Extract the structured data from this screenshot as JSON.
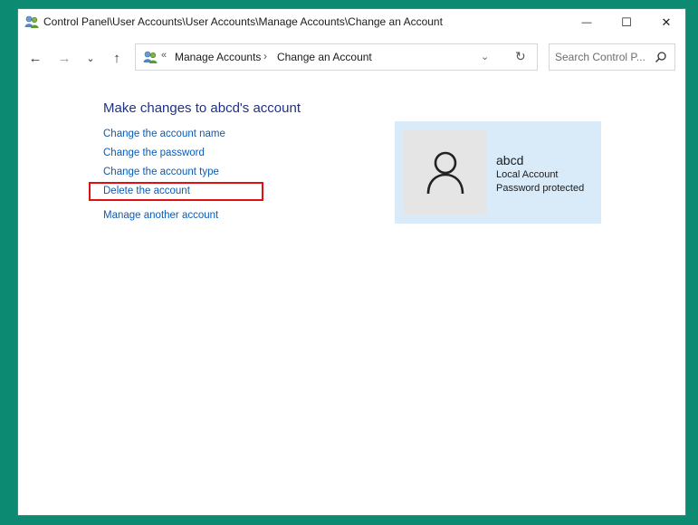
{
  "window": {
    "title": "Control Panel\\User Accounts\\User Accounts\\Manage Accounts\\Change an Account",
    "minimize_glyph": "—",
    "maximize_glyph": "☐",
    "close_glyph": "✕"
  },
  "nav": {
    "back_glyph": "←",
    "forward_glyph": "→",
    "recent_glyph": "⌄",
    "up_glyph": "↑"
  },
  "address": {
    "overflow_glyph": "«",
    "crumbs": [
      "Manage Accounts",
      "Change an Account"
    ],
    "separator_glyph": "›",
    "dropdown_glyph": "⌄",
    "refresh_glyph": "↻"
  },
  "search": {
    "placeholder": "Search Control P..."
  },
  "main": {
    "heading": "Make changes to abcd's account",
    "links": {
      "change_name": "Change the account name",
      "change_password": "Change the password",
      "change_type": "Change the account type",
      "delete": "Delete the account",
      "manage_another": "Manage another account"
    }
  },
  "user": {
    "name": "abcd",
    "account_type": "Local Account",
    "password_status": "Password protected"
  },
  "colors": {
    "desktop": "#0c8a72",
    "link": "#0b5bb5",
    "heading": "#1e3287",
    "card": "#d9ebf9",
    "highlight": "#e01010"
  },
  "icons": [
    "user-accounts-icon",
    "back-arrow-icon",
    "forward-arrow-icon",
    "chevron-down-icon",
    "up-arrow-icon",
    "refresh-icon",
    "search-icon",
    "user-avatar-icon"
  ]
}
